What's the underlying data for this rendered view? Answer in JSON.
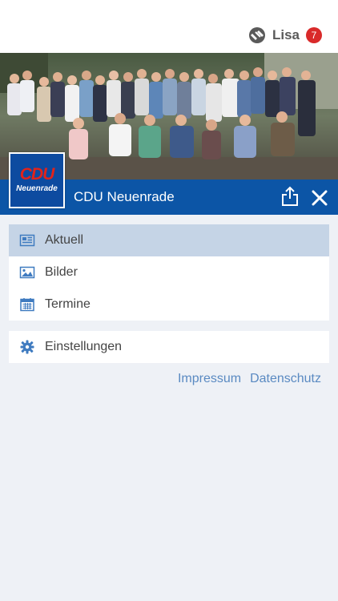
{
  "header": {
    "user_name": "Lisa",
    "notification_count": "7",
    "icons": [
      "app-logo-icon"
    ]
  },
  "hero": {
    "image": "group-photo"
  },
  "party": {
    "logo_text": "CDU",
    "logo_subtext": "Neuenrade",
    "title": "CDU Neuenrade"
  },
  "toolbar": {
    "icons": [
      "share-icon",
      "close-icon"
    ]
  },
  "menu": {
    "items": [
      {
        "label": "Aktuell",
        "icon": "news-icon",
        "active": true
      },
      {
        "label": "Bilder",
        "icon": "image-icon",
        "active": false
      },
      {
        "label": "Termine",
        "icon": "calendar-icon",
        "active": false
      }
    ],
    "settings": {
      "label": "Einstellungen",
      "icon": "gear-icon"
    }
  },
  "footer_links": {
    "impressum": "Impressum",
    "datenschutz": "Datenschutz"
  },
  "colors": {
    "brand_blue": "#0c55a6",
    "active_item": "#c5d4e6",
    "link": "#5a8ac2",
    "badge": "#d92a2a",
    "background": "#eef1f6"
  }
}
